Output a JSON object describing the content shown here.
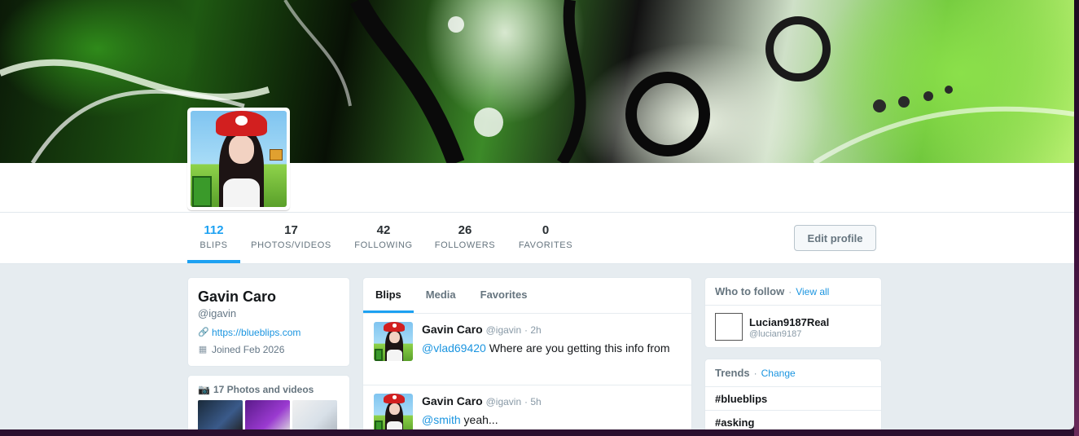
{
  "profile": {
    "name": "Gavin Caro",
    "handle": "@igavin",
    "url": "https://blueblips.com",
    "joined": "Joined Feb 2026"
  },
  "stats": [
    {
      "num": "112",
      "label": "BLIPS",
      "active": true
    },
    {
      "num": "17",
      "label": "PHOTOS/VIDEOS"
    },
    {
      "num": "42",
      "label": "FOLLOWING"
    },
    {
      "num": "26",
      "label": "FOLLOWERS"
    },
    {
      "num": "0",
      "label": "FAVORITES"
    }
  ],
  "edit_profile_label": "Edit profile",
  "photos": {
    "title": "17 Photos and videos",
    "icon": "camera-icon"
  },
  "timeline": {
    "tabs": [
      "Blips",
      "Media",
      "Favorites"
    ],
    "tweets": [
      {
        "name": "Gavin Caro",
        "handle": "@igavin",
        "time": "· 2h",
        "mention": "@vlad69420",
        "text": " Where are you getting this info from"
      },
      {
        "name": "Gavin Caro",
        "handle": "@igavin",
        "time": "· 5h",
        "mention": "@smith",
        "text": " yeah..."
      }
    ]
  },
  "who_to_follow": {
    "title": "Who to follow",
    "dot": "·",
    "link": "View all",
    "user": {
      "name": "Lucian9187Real",
      "handle": "@lucian9187"
    }
  },
  "trends": {
    "title": "Trends",
    "dot": "·",
    "link": "Change",
    "items": [
      "#blueblips",
      "#asking"
    ]
  },
  "colors": {
    "accent": "#1da1f2",
    "link": "#1b95e0",
    "background": "#e6ecf0"
  }
}
